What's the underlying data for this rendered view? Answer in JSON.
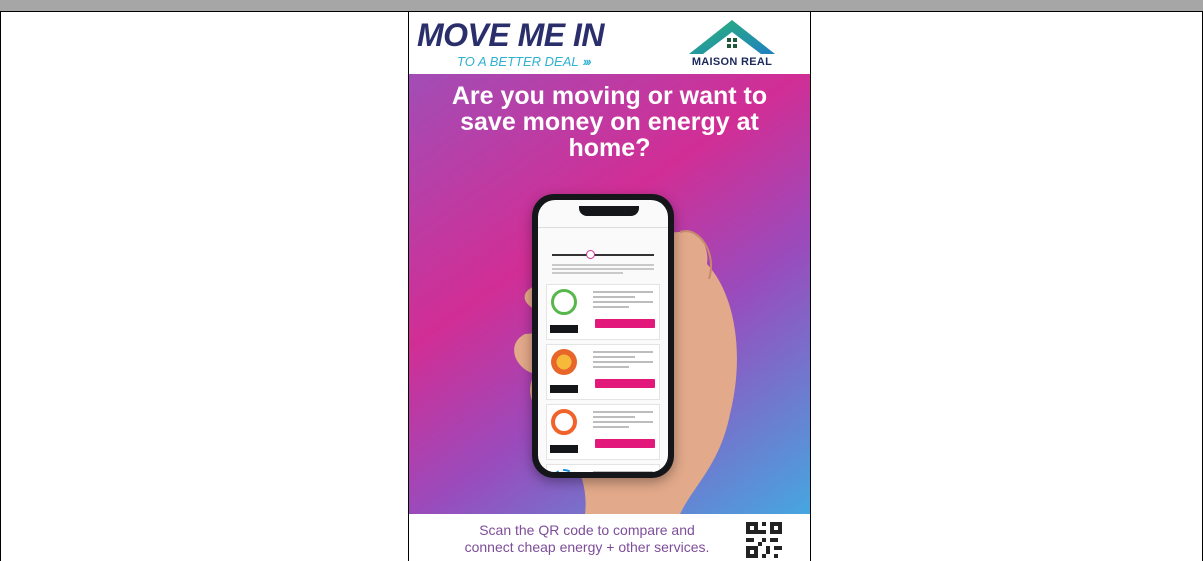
{
  "poster": {
    "brand_title": "MOVE ME IN",
    "brand_subtitle": "TO A BETTER DEAL",
    "partner_logo_text": "MAISON REAL",
    "headline": "Are you moving or want to save money on energy at home?",
    "footer_line1": "Scan the QR code to compare and",
    "footer_line2": "connect cheap energy + other services."
  },
  "colors": {
    "accent_pink": "#d12e95",
    "accent_purple": "#7e4d9a",
    "accent_blue": "#2fb1d1",
    "brand_navy": "#2a2f6b",
    "roof_green": "#2bb673"
  },
  "icons": {
    "qr": "qr-code-icon",
    "roof": "house-roof-icon",
    "plug_face": "plug-smiley-icon"
  }
}
